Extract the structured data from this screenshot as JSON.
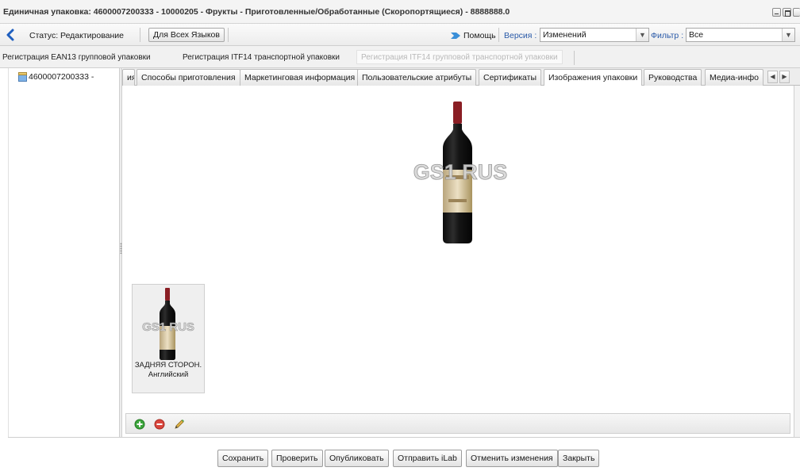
{
  "window": {
    "title": "Единичная упаковка: 4600007200333 - 10000205 - Фрукты - Приготовленные/Обработанные (Скоропортящиеся) - 8888888.0"
  },
  "toolbar": {
    "status_text": "Статус: Редактирование",
    "all_languages_button": "Для Всех Языков",
    "help_label": "Помощь",
    "version_label": "Версия :",
    "version_value": "Изменений",
    "filter_label": "Фильтр :",
    "filter_value": "Все"
  },
  "registration_tabs": [
    {
      "label": "Регистрация EAN13 групповой упаковки",
      "enabled": true
    },
    {
      "label": "Регистрация ITF14 транспортной упаковки",
      "enabled": true
    },
    {
      "label": "Регистрация ITF14 групповой транспортной упаковки",
      "enabled": false
    }
  ],
  "tree": {
    "item_label": "4600007200333 -"
  },
  "tabs": [
    {
      "label": "ия",
      "active": false
    },
    {
      "label": "Способы приготовления",
      "active": false
    },
    {
      "label": "Маркетинговая информация",
      "active": false
    },
    {
      "label": "Пользовательские атрибуты",
      "active": false
    },
    {
      "label": "Сертификаты",
      "active": false
    },
    {
      "label": "Изображения упаковки",
      "active": true
    },
    {
      "label": "Руководства",
      "active": false
    },
    {
      "label": "Медиа-инфо",
      "active": false
    }
  ],
  "images": {
    "watermark": "GS1 RUS",
    "thumbnail_caption": "ЗАДНЯЯ СТОРОН.",
    "thumbnail_language": "Английский"
  },
  "image_tools": [
    "add-icon",
    "remove-icon",
    "edit-icon"
  ],
  "actions": {
    "save": "Сохранить",
    "check": "Проверить",
    "publish": "Опубликовать",
    "send_ilab": "Отправить iLab",
    "cancel_changes": "Отменить изменения",
    "close": "Закрыть"
  },
  "colors": {
    "accent_blue": "#1f5fbf",
    "help_arrow": "#3a8fd8",
    "add_green": "#3ba53b",
    "remove_red": "#d9453c"
  }
}
